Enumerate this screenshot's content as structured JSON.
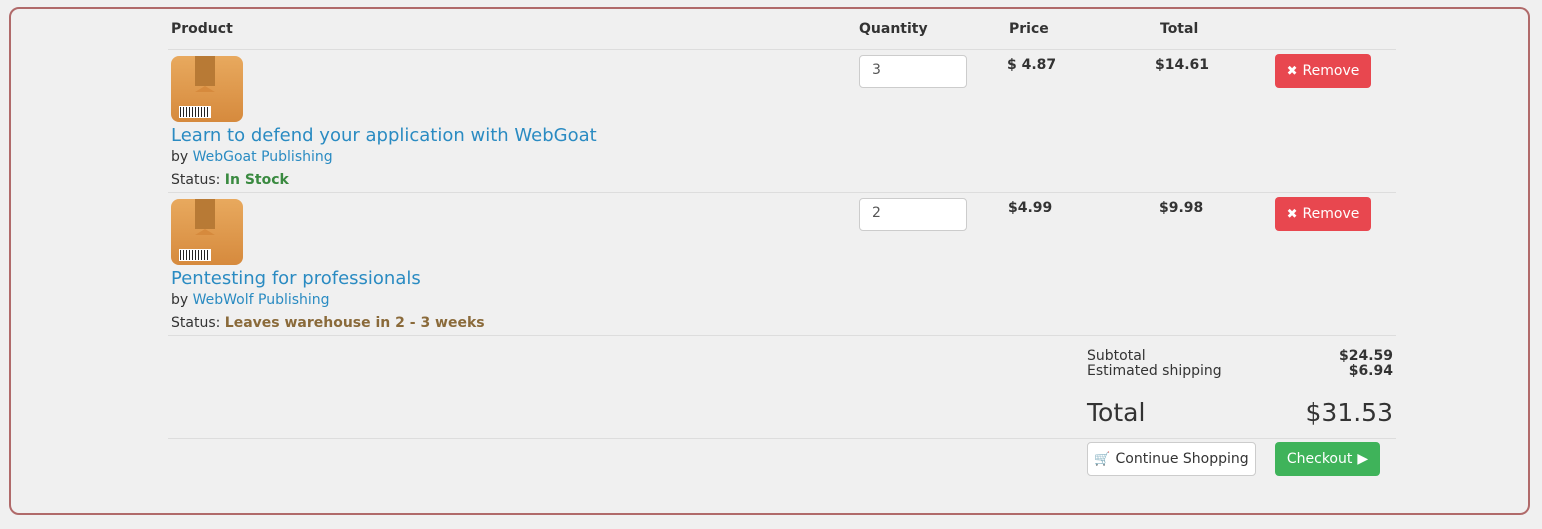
{
  "headers": {
    "product": "Product",
    "quantity": "Quantity",
    "price": "Price",
    "total": "Total"
  },
  "items": [
    {
      "title": "Learn to defend your application with WebGoat",
      "by": "by",
      "publisher": "WebGoat Publishing",
      "status_label": "Status:",
      "status": "In Stock",
      "quantity": "3",
      "price": "$ 4.87",
      "total": "$14.61",
      "remove_label": "Remove"
    },
    {
      "title": "Pentesting for professionals",
      "by": "by",
      "publisher": "WebWolf Publishing",
      "status_label": "Status:",
      "status": "Leaves warehouse in 2 - 3 weeks",
      "quantity": "2",
      "price": "$4.99",
      "total": "$9.98",
      "remove_label": "Remove"
    }
  ],
  "summary": {
    "subtotal_label": "Subtotal",
    "subtotal": "$24.59",
    "shipping_label": "Estimated shipping",
    "shipping": "$6.94",
    "total_label": "Total",
    "total": "$31.53"
  },
  "actions": {
    "continue_label": "Continue Shopping",
    "checkout_label": "Checkout"
  },
  "icons": {
    "remove": "x-icon",
    "cart": "cart-icon",
    "play": "play-icon",
    "product": "package-icon"
  },
  "colors": {
    "remove": "#e8474f",
    "checkout": "#3fb35a",
    "link": "#2a8bc2",
    "in_stock": "#3a8a40",
    "leaves": "#8a6a3a"
  }
}
